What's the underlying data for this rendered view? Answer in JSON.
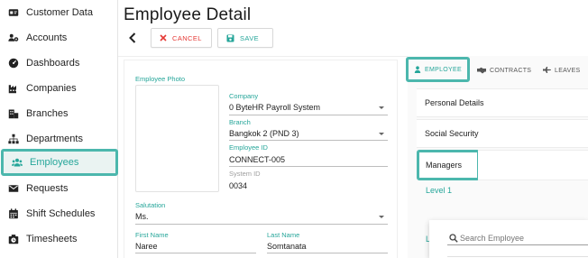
{
  "sidebar": {
    "items": [
      {
        "label": "Customer Data",
        "icon": "id-card-icon"
      },
      {
        "label": "Accounts",
        "icon": "users-gear-icon"
      },
      {
        "label": "Dashboards",
        "icon": "dashboard-icon"
      },
      {
        "label": "Companies",
        "icon": "industry-icon"
      },
      {
        "label": "Branches",
        "icon": "building-icon"
      },
      {
        "label": "Departments",
        "icon": "sitemap-icon"
      },
      {
        "label": "Employees",
        "icon": "users-icon",
        "active": true
      },
      {
        "label": "Requests",
        "icon": "inbox-icon"
      },
      {
        "label": "Shift Schedules",
        "icon": "calendar-icon"
      },
      {
        "label": "Timesheets",
        "icon": "clock-icon"
      }
    ]
  },
  "header": {
    "title": "Employee Detail",
    "cancel_label": "CANCEL",
    "save_label": "SAVE"
  },
  "form": {
    "photo_label": "Employee Photo",
    "company_label": "Company",
    "company_value": "0 ByteHR Payroll System",
    "branch_label": "Branch",
    "branch_value": "Bangkok 2 (PND 3)",
    "employee_id_label": "Employee ID",
    "employee_id_value": "CONNECT-005",
    "system_id_label": "System ID",
    "system_id_value": "0034",
    "salutation_label": "Salutation",
    "salutation_value": "Ms.",
    "first_name_label": "First Name",
    "first_name_value": "Naree",
    "last_name_label": "Last Name",
    "last_name_value": "Somtanata"
  },
  "tabs": {
    "employee": "EMPLOYEE",
    "contracts": "CONTRACTS",
    "leaves": "LEAVES"
  },
  "panel": {
    "personal_details": "Personal Details",
    "social_security": "Social Security",
    "managers": "Managers",
    "level1": "Level 1",
    "level_partial": "Le"
  },
  "search": {
    "placeholder": "Search Employee"
  },
  "colors": {
    "accent": "#26a69a",
    "highlight": "#4cb7ad",
    "danger": "#e53935"
  }
}
